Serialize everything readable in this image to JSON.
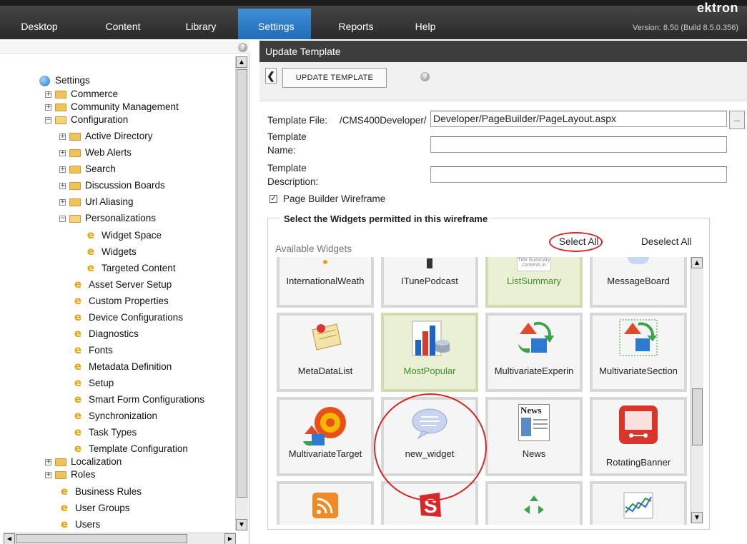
{
  "nav": {
    "tabs": [
      "Desktop",
      "Content",
      "Library",
      "Settings",
      "Reports",
      "Help"
    ],
    "active": "Settings",
    "brand": "ektron",
    "version": "Version: 8.50 (Build 8.5.0.356)"
  },
  "tree": {
    "root": "Settings",
    "commerce": "Commerce",
    "community": "Community Management",
    "configuration": "Configuration",
    "active_directory": "Active Directory",
    "web_alerts": "Web Alerts",
    "search": "Search",
    "discussion_boards": "Discussion Boards",
    "url_aliasing": "Url Aliasing",
    "personalizations": "Personalizations",
    "widget_space": "Widget Space",
    "widgets": "Widgets",
    "targeted_content": "Targeted Content",
    "asset_server": "Asset Server Setup",
    "custom_properties": "Custom Properties",
    "device_config": "Device Configurations",
    "diagnostics": "Diagnostics",
    "fonts": "Fonts",
    "metadata_def": "Metadata Definition",
    "setup": "Setup",
    "smart_form": "Smart Form Configurations",
    "synchronization": "Synchronization",
    "task_types": "Task Types",
    "template_config": "Template Configuration",
    "localization": "Localization",
    "roles": "Roles",
    "business_rules": "Business Rules",
    "user_groups": "User Groups",
    "users": "Users"
  },
  "page": {
    "header": "Update Template",
    "update_btn": "UPDATE TEMPLATE",
    "template_file_label": "Template File:",
    "template_file_prefix": "/CMS400Developer/",
    "template_file_value": "Developer/PageBuilder/PageLayout.aspx",
    "browse": "...",
    "template_name_label_1": "Template",
    "template_name_label_2": "Name:",
    "template_desc_label_1": "Template",
    "template_desc_label_2": "Description:",
    "wireframe_label": "Page Builder Wireframe",
    "legend": "Select the Widgets permitted in this wireframe",
    "select_all": "Select All",
    "deselect_all": "Deselect All",
    "available": "Available Widgets"
  },
  "widgets": {
    "w1": "InternationalWeath",
    "w2": "ITunePodcast",
    "w3": "ListSummary",
    "w4": "MessageBoard",
    "w5": "MetaDataList",
    "w6": "MostPopular",
    "w7": "MultivariateExperin",
    "w8": "MultivariateSection",
    "w9": "MultivariateTarget",
    "w10": "new_widget",
    "w11": "News",
    "w12": "RotatingBanner",
    "summary_text": "Title Summary contents in",
    "news_text": "News"
  }
}
